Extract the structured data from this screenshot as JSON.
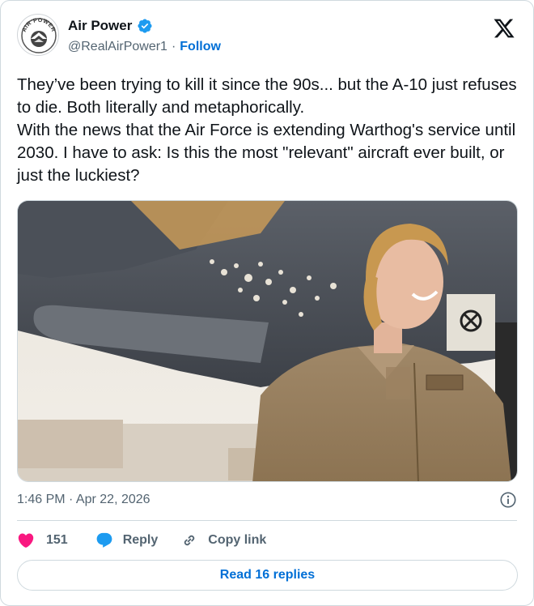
{
  "author": {
    "display_name": "Air Power",
    "handle": "@RealAirPower1",
    "follow_label": "Follow",
    "avatar_text": "AIR POWER",
    "verified": true
  },
  "post": {
    "text": "They’ve been trying to kill it since the 90s... but the A-10 just refuses to die. Both literally and metaphorically.\nWith the news that the Air Force is extending Warthog's service until 2030. I have to ask: Is this the most \"relevant\" aircraft ever built, or just the luckiest?",
    "timestamp": "1:46 PM · Apr 22, 2026",
    "image_description_icon": "photo"
  },
  "actions": {
    "like_count": "151",
    "reply_label": "Reply",
    "copy_link_label": "Copy link",
    "read_replies_label": "Read 16 replies"
  },
  "colors": {
    "accent": "#006fd6",
    "like": "#f91880",
    "verified": "#1d9bf0",
    "muted": "#536471",
    "border": "#cfd9de"
  }
}
